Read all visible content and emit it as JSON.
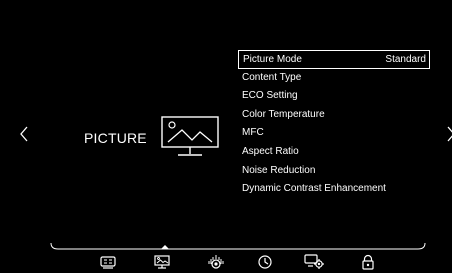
{
  "category": {
    "label": "PICTURE",
    "icon": "tv-picture-icon"
  },
  "menu": {
    "items": [
      {
        "label": "Picture Mode",
        "value": "Standard",
        "selected": true
      },
      {
        "label": "Content Type"
      },
      {
        "label": "ECO Setting"
      },
      {
        "label": "Color Temperature"
      },
      {
        "label": "MFC"
      },
      {
        "label": "Aspect Ratio"
      },
      {
        "label": "Noise Reduction"
      },
      {
        "label": "Dynamic Contrast Enhancement"
      }
    ]
  },
  "navigation": {
    "left_icon": "chevron-left-icon",
    "right_icon": "chevron-right-icon"
  },
  "bottom_bar": {
    "icons": [
      {
        "name": "input-source-icon"
      },
      {
        "name": "picture-icon",
        "active": true
      },
      {
        "name": "sound-icon"
      },
      {
        "name": "timer-icon"
      },
      {
        "name": "settings-icon"
      },
      {
        "name": "lock-icon"
      }
    ]
  }
}
